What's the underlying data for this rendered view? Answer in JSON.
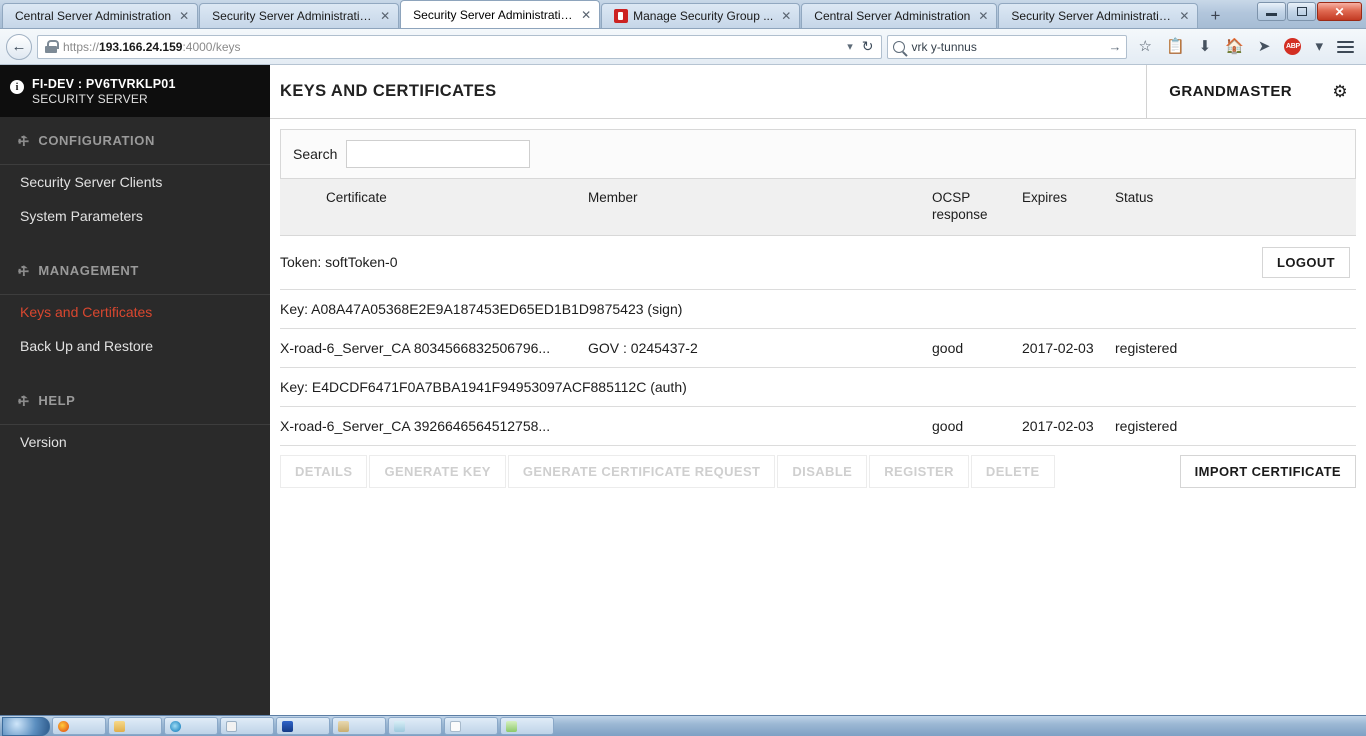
{
  "browser": {
    "tabs": [
      {
        "label": "Central Server Administration",
        "active": false,
        "favicon": false
      },
      {
        "label": "Security Server Administration",
        "active": false,
        "favicon": false
      },
      {
        "label": "Security Server Administration",
        "active": true,
        "favicon": false
      },
      {
        "label": "Manage Security Group ...",
        "active": false,
        "favicon": true
      },
      {
        "label": "Central Server Administration",
        "active": false,
        "favicon": false
      },
      {
        "label": "Security Server Administration",
        "active": false,
        "favicon": false
      }
    ],
    "new_tab_label": "+",
    "close_glyph": "✕",
    "window_controls": {
      "minimize": "minimize-icon",
      "maximize": "maximize-icon",
      "close": "✕"
    },
    "back_glyph": "←",
    "url_prefix": "https://",
    "url_host": "193.166.24.159",
    "url_suffix": ":4000/keys",
    "url_dropdown_glyph": "▾",
    "reload_glyph": "↻",
    "search_value": "vrk y-tunnus",
    "search_go_glyph": "→",
    "toolbar_icons": {
      "bookmark": "☆",
      "reader": "📋",
      "downloads": "⬇",
      "home": "🏠",
      "pocket": "➤",
      "adblock": "ABP",
      "adblock_caret": "▾"
    }
  },
  "sidebar": {
    "server_name": "FI-DEV : PV6TVRKLP01",
    "server_role": "SECURITY SERVER",
    "info_glyph": "i",
    "wrench_glyph": "⚒",
    "sections": [
      {
        "title": "CONFIGURATION",
        "items": [
          {
            "label": "Security Server Clients",
            "active": false
          },
          {
            "label": "System Parameters",
            "active": false
          }
        ]
      },
      {
        "title": "MANAGEMENT",
        "items": [
          {
            "label": "Keys and Certificates",
            "active": true
          },
          {
            "label": "Back Up and Restore",
            "active": false
          }
        ]
      },
      {
        "title": "HELP",
        "items": [
          {
            "label": "Version",
            "active": false
          }
        ]
      }
    ]
  },
  "header": {
    "title": "KEYS AND CERTIFICATES",
    "user": "GRANDMASTER",
    "gear_glyph": "⚙"
  },
  "search": {
    "label": "Search",
    "value": "",
    "placeholder": ""
  },
  "table": {
    "columns": {
      "certificate": "Certificate",
      "member": "Member",
      "ocsp_line1": "OCSP",
      "ocsp_line2": "response",
      "expires": "Expires",
      "status": "Status"
    },
    "token": {
      "label": "Token: softToken-0",
      "logout_label": "LOGOUT"
    },
    "groups": [
      {
        "key_label": "Key: A08A47A05368E2E9A187453ED65ED1B1D9875423 (sign)",
        "certs": [
          {
            "certificate": "X-road-6_Server_CA 8034566832506796...",
            "member": "GOV : 0245437-2",
            "ocsp": "good",
            "expires": "2017-02-03",
            "status": "registered"
          }
        ]
      },
      {
        "key_label": "Key: E4DCDF6471F0A7BBA1941F94953097ACF885112C (auth)",
        "certs": [
          {
            "certificate": "X-road-6_Server_CA 3926646564512758...",
            "member": "",
            "ocsp": "good",
            "expires": "2017-02-03",
            "status": "registered"
          }
        ]
      }
    ]
  },
  "actions": {
    "details": "DETAILS",
    "generate_key": "GENERATE KEY",
    "generate_certificate_request": "GENERATE CERTIFICATE REQUEST",
    "disable": "DISABLE",
    "register": "REGISTER",
    "delete": "DELETE",
    "import_certificate": "IMPORT CERTIFICATE"
  },
  "colors": {
    "accent_active": "#d9472f",
    "sidebar_bg": "#2a2a2a",
    "sidebar_header_bg": "#0e0e0e"
  }
}
